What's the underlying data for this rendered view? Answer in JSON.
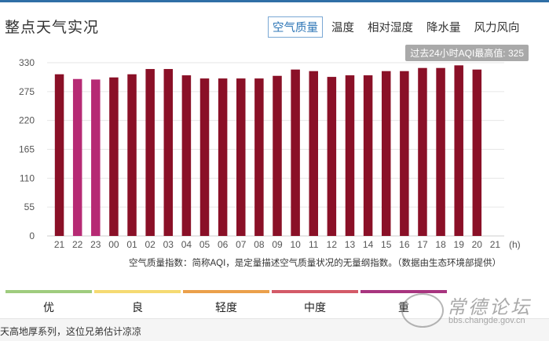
{
  "panel": {
    "title": "整点天气实况"
  },
  "tabs": [
    {
      "label": "空气质量",
      "active": true
    },
    {
      "label": "温度",
      "active": false
    },
    {
      "label": "相对湿度",
      "active": false
    },
    {
      "label": "降水量",
      "active": false
    },
    {
      "label": "风力风向",
      "active": false
    }
  ],
  "max_badge": "过去24小时AQI最高值: 325",
  "chart_data": {
    "type": "bar",
    "title": "",
    "xlabel": "",
    "ylabel": "",
    "x_unit": "(h)",
    "categories": [
      "21",
      "22",
      "23",
      "00",
      "01",
      "02",
      "03",
      "04",
      "05",
      "06",
      "07",
      "08",
      "09",
      "10",
      "11",
      "12",
      "13",
      "14",
      "15",
      "16",
      "17",
      "18",
      "19",
      "20",
      "21"
    ],
    "values": [
      308,
      299,
      298,
      302,
      308,
      318,
      318,
      306,
      300,
      300,
      300,
      300,
      305,
      317,
      314,
      303,
      306,
      306,
      314,
      314,
      320,
      320,
      325,
      317,
      null
    ],
    "bar_colors": [
      "#8a1027",
      "#b62a74",
      "#b62a74",
      "#8a1027",
      "#8a1027",
      "#8a1027",
      "#8a1027",
      "#8a1027",
      "#8a1027",
      "#8a1027",
      "#8a1027",
      "#8a1027",
      "#8a1027",
      "#8a1027",
      "#8a1027",
      "#8a1027",
      "#8a1027",
      "#8a1027",
      "#8a1027",
      "#8a1027",
      "#8a1027",
      "#8a1027",
      "#8a1027",
      "#8a1027",
      "#8a1027"
    ],
    "ylim": [
      0,
      330
    ],
    "yticks": [
      0,
      55,
      110,
      165,
      220,
      275,
      330
    ],
    "grid": true,
    "note": "空气质量指数：简称AQI，是定量描述空气质量状况的无量纲指数。（数据由生态环境部提供）"
  },
  "legend": {
    "items": [
      {
        "label": "优",
        "color": "#9fcc7e"
      },
      {
        "label": "良",
        "color": "#f5da72"
      },
      {
        "label": "轻度",
        "color": "#eba04b"
      },
      {
        "label": "中度",
        "color": "#d35a68"
      },
      {
        "label": "重",
        "color": "#a8357f"
      }
    ]
  },
  "comment": {
    "text": "天高地厚系列，这位兄弟估计凉凉"
  },
  "watermark": {
    "name": "常德论坛",
    "url": "bbs.changde.gov.cn"
  }
}
